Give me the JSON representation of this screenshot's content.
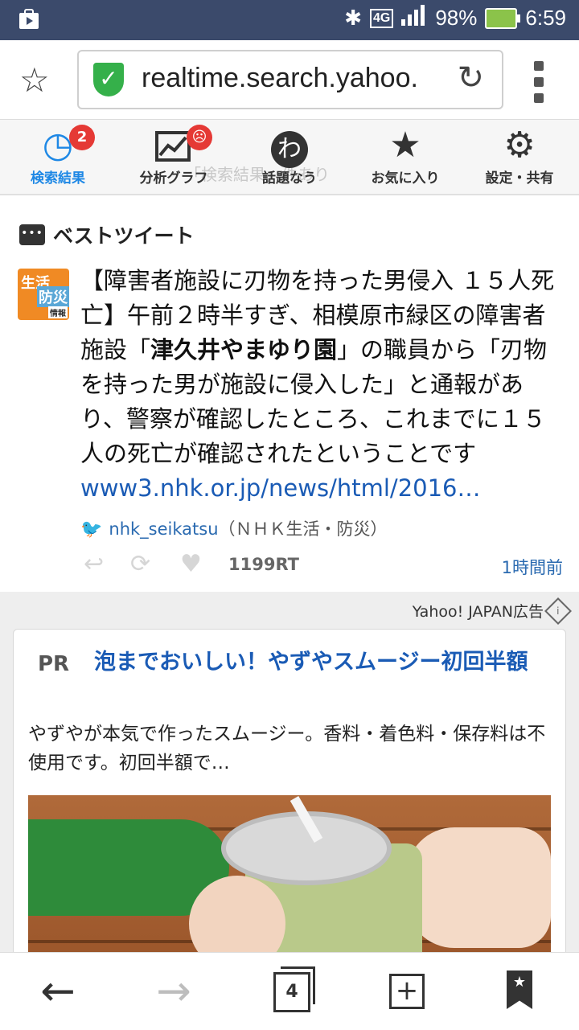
{
  "status_bar": {
    "network": "4G",
    "battery": "98%",
    "time": "6:59"
  },
  "browser": {
    "url": "realtime.search.yahoo."
  },
  "tabs": [
    {
      "label": "検索結果",
      "badge": "2"
    },
    {
      "label": "分析グラフ",
      "badge": "☹"
    },
    {
      "label": "話題なう",
      "icon_text": "わ"
    },
    {
      "label": "お気に入り"
    },
    {
      "label": "設定・共有"
    }
  ],
  "ghost_text": "「検索結果」件あり",
  "tweet": {
    "section_title": "ベストツイート",
    "avatar_text": {
      "a1": "生活",
      "a2": "防災",
      "a3": "情報"
    },
    "text_part1": "【障害者施設に刃物を持った男侵入 １５人死亡】午前２時半すぎ、相模原市緑区の障害者施設「",
    "text_bold": "津久井やまゆり園",
    "text_part2": "」の職員から「刃物を持った男が施設に侵入した」と通報があり、警察が確認したところ、これまでに１５人の死亡が確認されたということです",
    "link": "www3.nhk.or.jp/news/html/2016…",
    "handle": "nhk_seikatsu",
    "display_name": "（ＮＨＫ生活・防災）",
    "rt_count": "1199RT",
    "time_ago": "1時間前"
  },
  "ad": {
    "label": "Yahoo! JAPAN広告",
    "pr": "PR",
    "title": "泡までおいしい！やずやスムージー初回半額",
    "description": "やずやが本気で作ったスムージー。香料・着色料・保存料は不使用です。初回半額で…"
  },
  "bottom_nav": {
    "tab_count": "4"
  }
}
